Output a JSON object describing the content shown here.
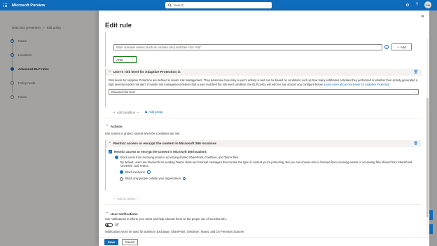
{
  "app": {
    "title": "Microsoft Purview"
  },
  "search": {
    "placeholder": "Search"
  },
  "user": {
    "initials": "RM"
  },
  "breadcrumb": [
    "Data loss prevention",
    ">",
    "Edit policy"
  ],
  "steps": [
    {
      "label": "Name",
      "state": "done"
    },
    {
      "label": "Locations",
      "state": "done"
    },
    {
      "label": "Advanced DLP rules",
      "state": "current"
    },
    {
      "label": "Policy mode",
      "state": "todo"
    },
    {
      "label": "Finish",
      "state": "todo"
    }
  ],
  "panel": {
    "title": "Edit rule",
    "domain_input_placeholder": "Enter domains names (such as contoso.com) and then click 'Add'.",
    "add_button": "Add",
    "operator": "AND",
    "risk_section": {
      "title": "User's risk level for Adaptive Protection is",
      "description": "Risk levels for Adaptive Protection are defined in insider risk management. They determine how risky a user's activity is and can be based on conditions such as how many exfiltration activities they performed or whether their activity generated a high severity insider risk alert. If insider risk management detects that a user matched the risk level condition, the DLP policy will enforce any actions you configure below.",
      "learn_more": "Learn more about risk levels for Adaptive Protection",
      "selected_level": "Elevated risk level"
    },
    "add_condition": "Add condition",
    "add_group": "Add group",
    "actions_heading": "Actions",
    "actions_intro": "Use actions to protect content when the conditions are met.",
    "restrict_section": {
      "title": "Restrict access or encrypt the content in Microsoft 365 locations",
      "checkbox_label": "Restrict access or encrypt the content in Microsoft 365 locations",
      "block_users_option": "Block users from receiving email or accessing shared SharePoint, OneDrive, and Teams files.",
      "block_users_desc": "By default, users are blocked from sending Teams chats and channel messages that contain the type of content you're protecting. But you can choose who is blocked from receiving emails or accessing files shared from SharePoint, OneDrive, and Teams.",
      "radio_everyone": "Block everyone",
      "radio_outside": "Block only people outside your organization"
    },
    "add_action": "Add an action",
    "notifications": {
      "heading": "User notifications",
      "intro": "Use notifications to inform your users and help educate them on the proper use of sensitive info.",
      "toggle_state": "Off",
      "note": "Notifications won't be used for activity in Exchange, SharePoint, OneDrive, Teams, and On Premises Scanner."
    },
    "save": "Save",
    "cancel": "Cancel"
  },
  "icons": {
    "waffle": "waffle-icon",
    "search": "search-icon",
    "settings": "gear-icon",
    "help": "help-icon",
    "close": "close-icon",
    "trash": "trash-icon",
    "info": "info-icon",
    "chevron": "chevron-down-icon"
  },
  "colors": {
    "brand": "#0f6cbd",
    "and_border": "#107c10"
  }
}
